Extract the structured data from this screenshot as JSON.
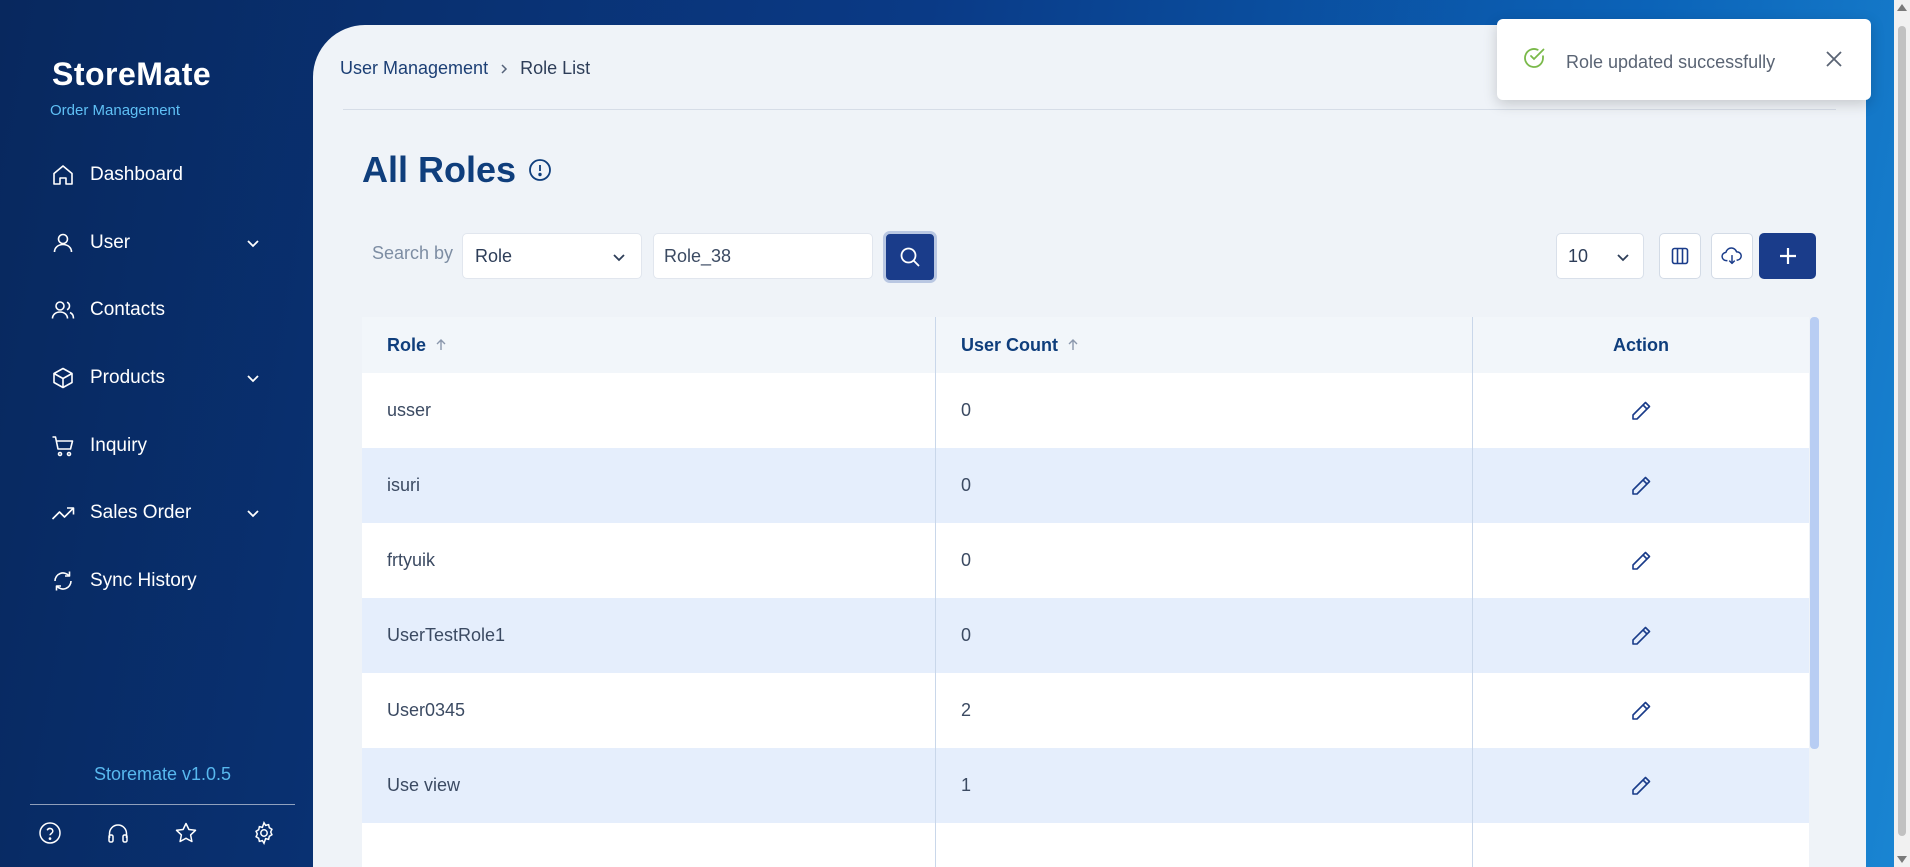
{
  "app": {
    "brand_name": "StoreMate",
    "subtitle": "Order Management",
    "version": "Storemate v1.0.5"
  },
  "sidebar": {
    "items": [
      {
        "label": "Dashboard",
        "icon": "home-icon",
        "expandable": false
      },
      {
        "label": "User",
        "icon": "user-icon",
        "expandable": true
      },
      {
        "label": "Contacts",
        "icon": "contacts-icon",
        "expandable": false
      },
      {
        "label": "Products",
        "icon": "box-icon",
        "expandable": true
      },
      {
        "label": "Inquiry",
        "icon": "cart-icon",
        "expandable": false
      },
      {
        "label": "Sales Order",
        "icon": "trending-up-icon",
        "expandable": true
      },
      {
        "label": "Sync History",
        "icon": "sync-icon",
        "expandable": false
      }
    ],
    "bottom_icons": [
      "help-icon",
      "headset-icon",
      "star-icon",
      "settings-icon"
    ]
  },
  "breadcrumb": {
    "parent": "User Management",
    "current": "Role List"
  },
  "page": {
    "title": "All Roles"
  },
  "toolbar": {
    "search_label": "Search by",
    "search_field": "Role",
    "search_value": "Role_38",
    "page_size": "10"
  },
  "table": {
    "columns": [
      "Role",
      "User Count",
      "Action"
    ],
    "rows": [
      {
        "role": "usser",
        "count": "0"
      },
      {
        "role": "isuri",
        "count": "0"
      },
      {
        "role": "frtyuik",
        "count": "0"
      },
      {
        "role": "UserTestRole1",
        "count": "0"
      },
      {
        "role": "User0345",
        "count": "2"
      },
      {
        "role": "Use view",
        "count": "1"
      }
    ]
  },
  "toast": {
    "message": "Role updated successfully"
  },
  "colors": {
    "accent": "#1a3c8a",
    "heading": "#0f3e7c",
    "success": "#7ab94a",
    "row_alt": "#e5eefc"
  }
}
